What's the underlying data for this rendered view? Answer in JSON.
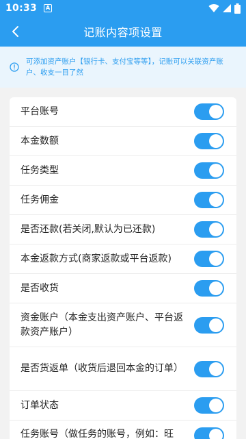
{
  "status_bar": {
    "time": "10:33",
    "notification_letter": "A"
  },
  "header": {
    "title": "记账内容项设置"
  },
  "tip": {
    "text": "可添加资产账户【银行卡、支付宝等等】，记账可以关联资产账户、收支一目了然"
  },
  "settings": [
    {
      "label": "平台账号",
      "enabled": true
    },
    {
      "label": "本金数额",
      "enabled": true
    },
    {
      "label": "任务类型",
      "enabled": true
    },
    {
      "label": "任务佣金",
      "enabled": true
    },
    {
      "label": "是否还款(若关闭,默认为已还款)",
      "enabled": true
    },
    {
      "label": "本金返款方式(商家返款或平台返款)",
      "enabled": true
    },
    {
      "label": "是否收货",
      "enabled": true
    },
    {
      "label": "资金账户（本金支出资产账户、平台返款资产账户）",
      "enabled": true
    },
    {
      "label": "是否货返单（收货后退回本金的订单）",
      "enabled": true
    },
    {
      "label": "订单状态",
      "enabled": true
    },
    {
      "label": "任务账号（做任务的账号，例如：旺",
      "enabled": true
    }
  ],
  "colors": {
    "accent": "#2b9df0",
    "background": "#f2f2f2"
  }
}
